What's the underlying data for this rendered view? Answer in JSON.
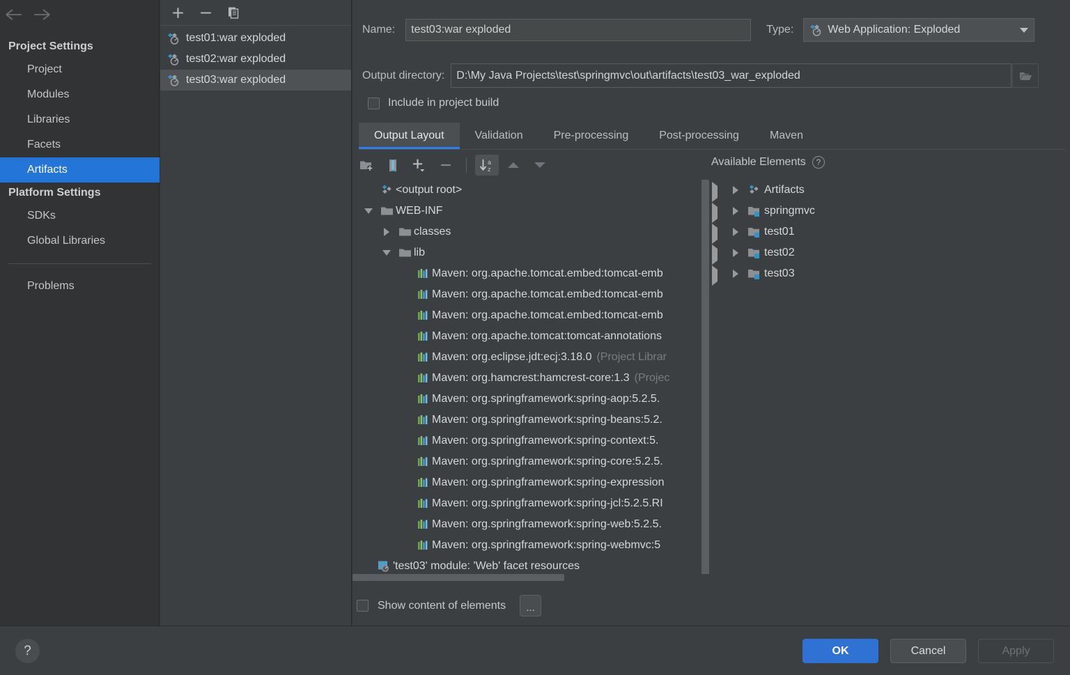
{
  "sidebar": {
    "nav": {
      "back": "←",
      "forward": "→"
    },
    "groups": [
      {
        "title": "Project Settings",
        "items": [
          {
            "label": "Project",
            "selected": false
          },
          {
            "label": "Modules",
            "selected": false
          },
          {
            "label": "Libraries",
            "selected": false
          },
          {
            "label": "Facets",
            "selected": false
          },
          {
            "label": "Artifacts",
            "selected": true
          }
        ]
      },
      {
        "title": "Platform Settings",
        "items": [
          {
            "label": "SDKs",
            "selected": false
          },
          {
            "label": "Global Libraries",
            "selected": false
          }
        ]
      }
    ],
    "extra": [
      {
        "label": "Problems",
        "selected": false
      }
    ]
  },
  "artifact_panel": {
    "toolbar": [
      {
        "name": "add-artifact-button",
        "glyph": "+"
      },
      {
        "name": "remove-artifact-button",
        "glyph": "−"
      },
      {
        "name": "copy-artifact-button",
        "glyph": "copy-icon"
      }
    ],
    "items": [
      {
        "label": "test01:war exploded",
        "selected": false
      },
      {
        "label": "test02:war exploded",
        "selected": false
      },
      {
        "label": "test03:war exploded",
        "selected": true
      }
    ]
  },
  "detail": {
    "name_label": "Name:",
    "name_value": "test03:war exploded",
    "type_label": "Type:",
    "type_value": "Web Application: Exploded",
    "output_dir_label": "Output directory:",
    "output_dir_value": "D:\\My Java Projects\\test\\springmvc\\out\\artifacts\\test03_war_exploded",
    "include_in_build_label": "Include in project build",
    "include_in_build_checked": false,
    "tabs": [
      {
        "label": "Output Layout",
        "active": true
      },
      {
        "label": "Validation",
        "active": false
      },
      {
        "label": "Pre-processing",
        "active": false
      },
      {
        "label": "Post-processing",
        "active": false
      },
      {
        "label": "Maven",
        "active": false
      }
    ],
    "layout_toolbar": [
      {
        "name": "create-directory-button",
        "icon": "folder-add-icon",
        "pressed": false
      },
      {
        "name": "create-archive-button",
        "icon": "archive-icon",
        "pressed": false
      },
      {
        "name": "add-copy-button",
        "icon": "plus-dropdown-icon",
        "pressed": false
      },
      {
        "name": "remove-element-button",
        "icon": "minus-icon",
        "pressed": false
      },
      {
        "name": "sort-button",
        "icon": "sort-az-icon",
        "pressed": true
      },
      {
        "name": "move-up-button",
        "icon": "arrow-up-icon",
        "pressed": false
      },
      {
        "name": "move-down-button",
        "icon": "arrow-down-icon",
        "pressed": false
      }
    ],
    "available_elements_title": "Available Elements",
    "show_content_label": "Show content of elements",
    "show_content_checked": false,
    "dots_button_label": "...",
    "output_tree": [
      {
        "indent": 0,
        "toggle": "none",
        "icon": "artifact-icon",
        "label": "<output root>"
      },
      {
        "indent": 0,
        "toggle": "down",
        "icon": "folder-icon",
        "label": "WEB-INF"
      },
      {
        "indent": 1,
        "toggle": "right",
        "icon": "folder-icon",
        "label": "classes"
      },
      {
        "indent": 1,
        "toggle": "down",
        "icon": "folder-icon",
        "label": "lib"
      },
      {
        "indent": 2,
        "toggle": "none",
        "icon": "library-icon",
        "label": "Maven: org.apache.tomcat.embed:tomcat-emb"
      },
      {
        "indent": 2,
        "toggle": "none",
        "icon": "library-icon",
        "label": "Maven: org.apache.tomcat.embed:tomcat-emb"
      },
      {
        "indent": 2,
        "toggle": "none",
        "icon": "library-icon",
        "label": "Maven: org.apache.tomcat.embed:tomcat-emb"
      },
      {
        "indent": 2,
        "toggle": "none",
        "icon": "library-icon",
        "label": "Maven: org.apache.tomcat:tomcat-annotations"
      },
      {
        "indent": 2,
        "toggle": "none",
        "icon": "library-icon",
        "label": "Maven: org.eclipse.jdt:ecj:3.18.0",
        "suffix": "(Project Librar"
      },
      {
        "indent": 2,
        "toggle": "none",
        "icon": "library-icon",
        "label": "Maven: org.hamcrest:hamcrest-core:1.3",
        "suffix": "(Projec"
      },
      {
        "indent": 2,
        "toggle": "none",
        "icon": "library-icon",
        "label": "Maven: org.springframework:spring-aop:5.2.5."
      },
      {
        "indent": 2,
        "toggle": "none",
        "icon": "library-icon",
        "label": "Maven: org.springframework:spring-beans:5.2."
      },
      {
        "indent": 2,
        "toggle": "none",
        "icon": "library-icon",
        "label": "Maven: org.springframework:spring-context:5."
      },
      {
        "indent": 2,
        "toggle": "none",
        "icon": "library-icon",
        "label": "Maven: org.springframework:spring-core:5.2.5."
      },
      {
        "indent": 2,
        "toggle": "none",
        "icon": "library-icon",
        "label": "Maven: org.springframework:spring-expression"
      },
      {
        "indent": 2,
        "toggle": "none",
        "icon": "library-icon",
        "label": "Maven: org.springframework:spring-jcl:5.2.5.RI"
      },
      {
        "indent": 2,
        "toggle": "none",
        "icon": "library-icon",
        "label": "Maven: org.springframework:spring-web:5.2.5."
      },
      {
        "indent": 2,
        "toggle": "none",
        "icon": "library-icon",
        "label": "Maven: org.springframework:spring-webmvc:5"
      },
      {
        "indent": 0,
        "toggle": "none",
        "icon": "facet-icon",
        "label": "'test03' module: 'Web' facet resources"
      }
    ],
    "available_tree": [
      {
        "toggle": "right",
        "icon": "artifact-icon",
        "label": "Artifacts"
      },
      {
        "toggle": "right",
        "icon": "module-icon",
        "label": "springmvc"
      },
      {
        "toggle": "right",
        "icon": "module-icon",
        "label": "test01"
      },
      {
        "toggle": "right",
        "icon": "module-icon",
        "label": "test02"
      },
      {
        "toggle": "right",
        "icon": "module-icon",
        "label": "test03"
      }
    ]
  },
  "bottom": {
    "help_label": "?",
    "ok_label": "OK",
    "cancel_label": "Cancel",
    "apply_label": "Apply"
  },
  "colors": {
    "accent_blue": "#2475d8",
    "ok_button": "#2f72d4",
    "panel_bg": "#3c3f41",
    "sidebar_bg": "#313335",
    "selection_gray": "#4e5254",
    "text": "#d6d6d6",
    "muted_text": "#7a7d7f",
    "icon_cyan": "#3592c4"
  }
}
